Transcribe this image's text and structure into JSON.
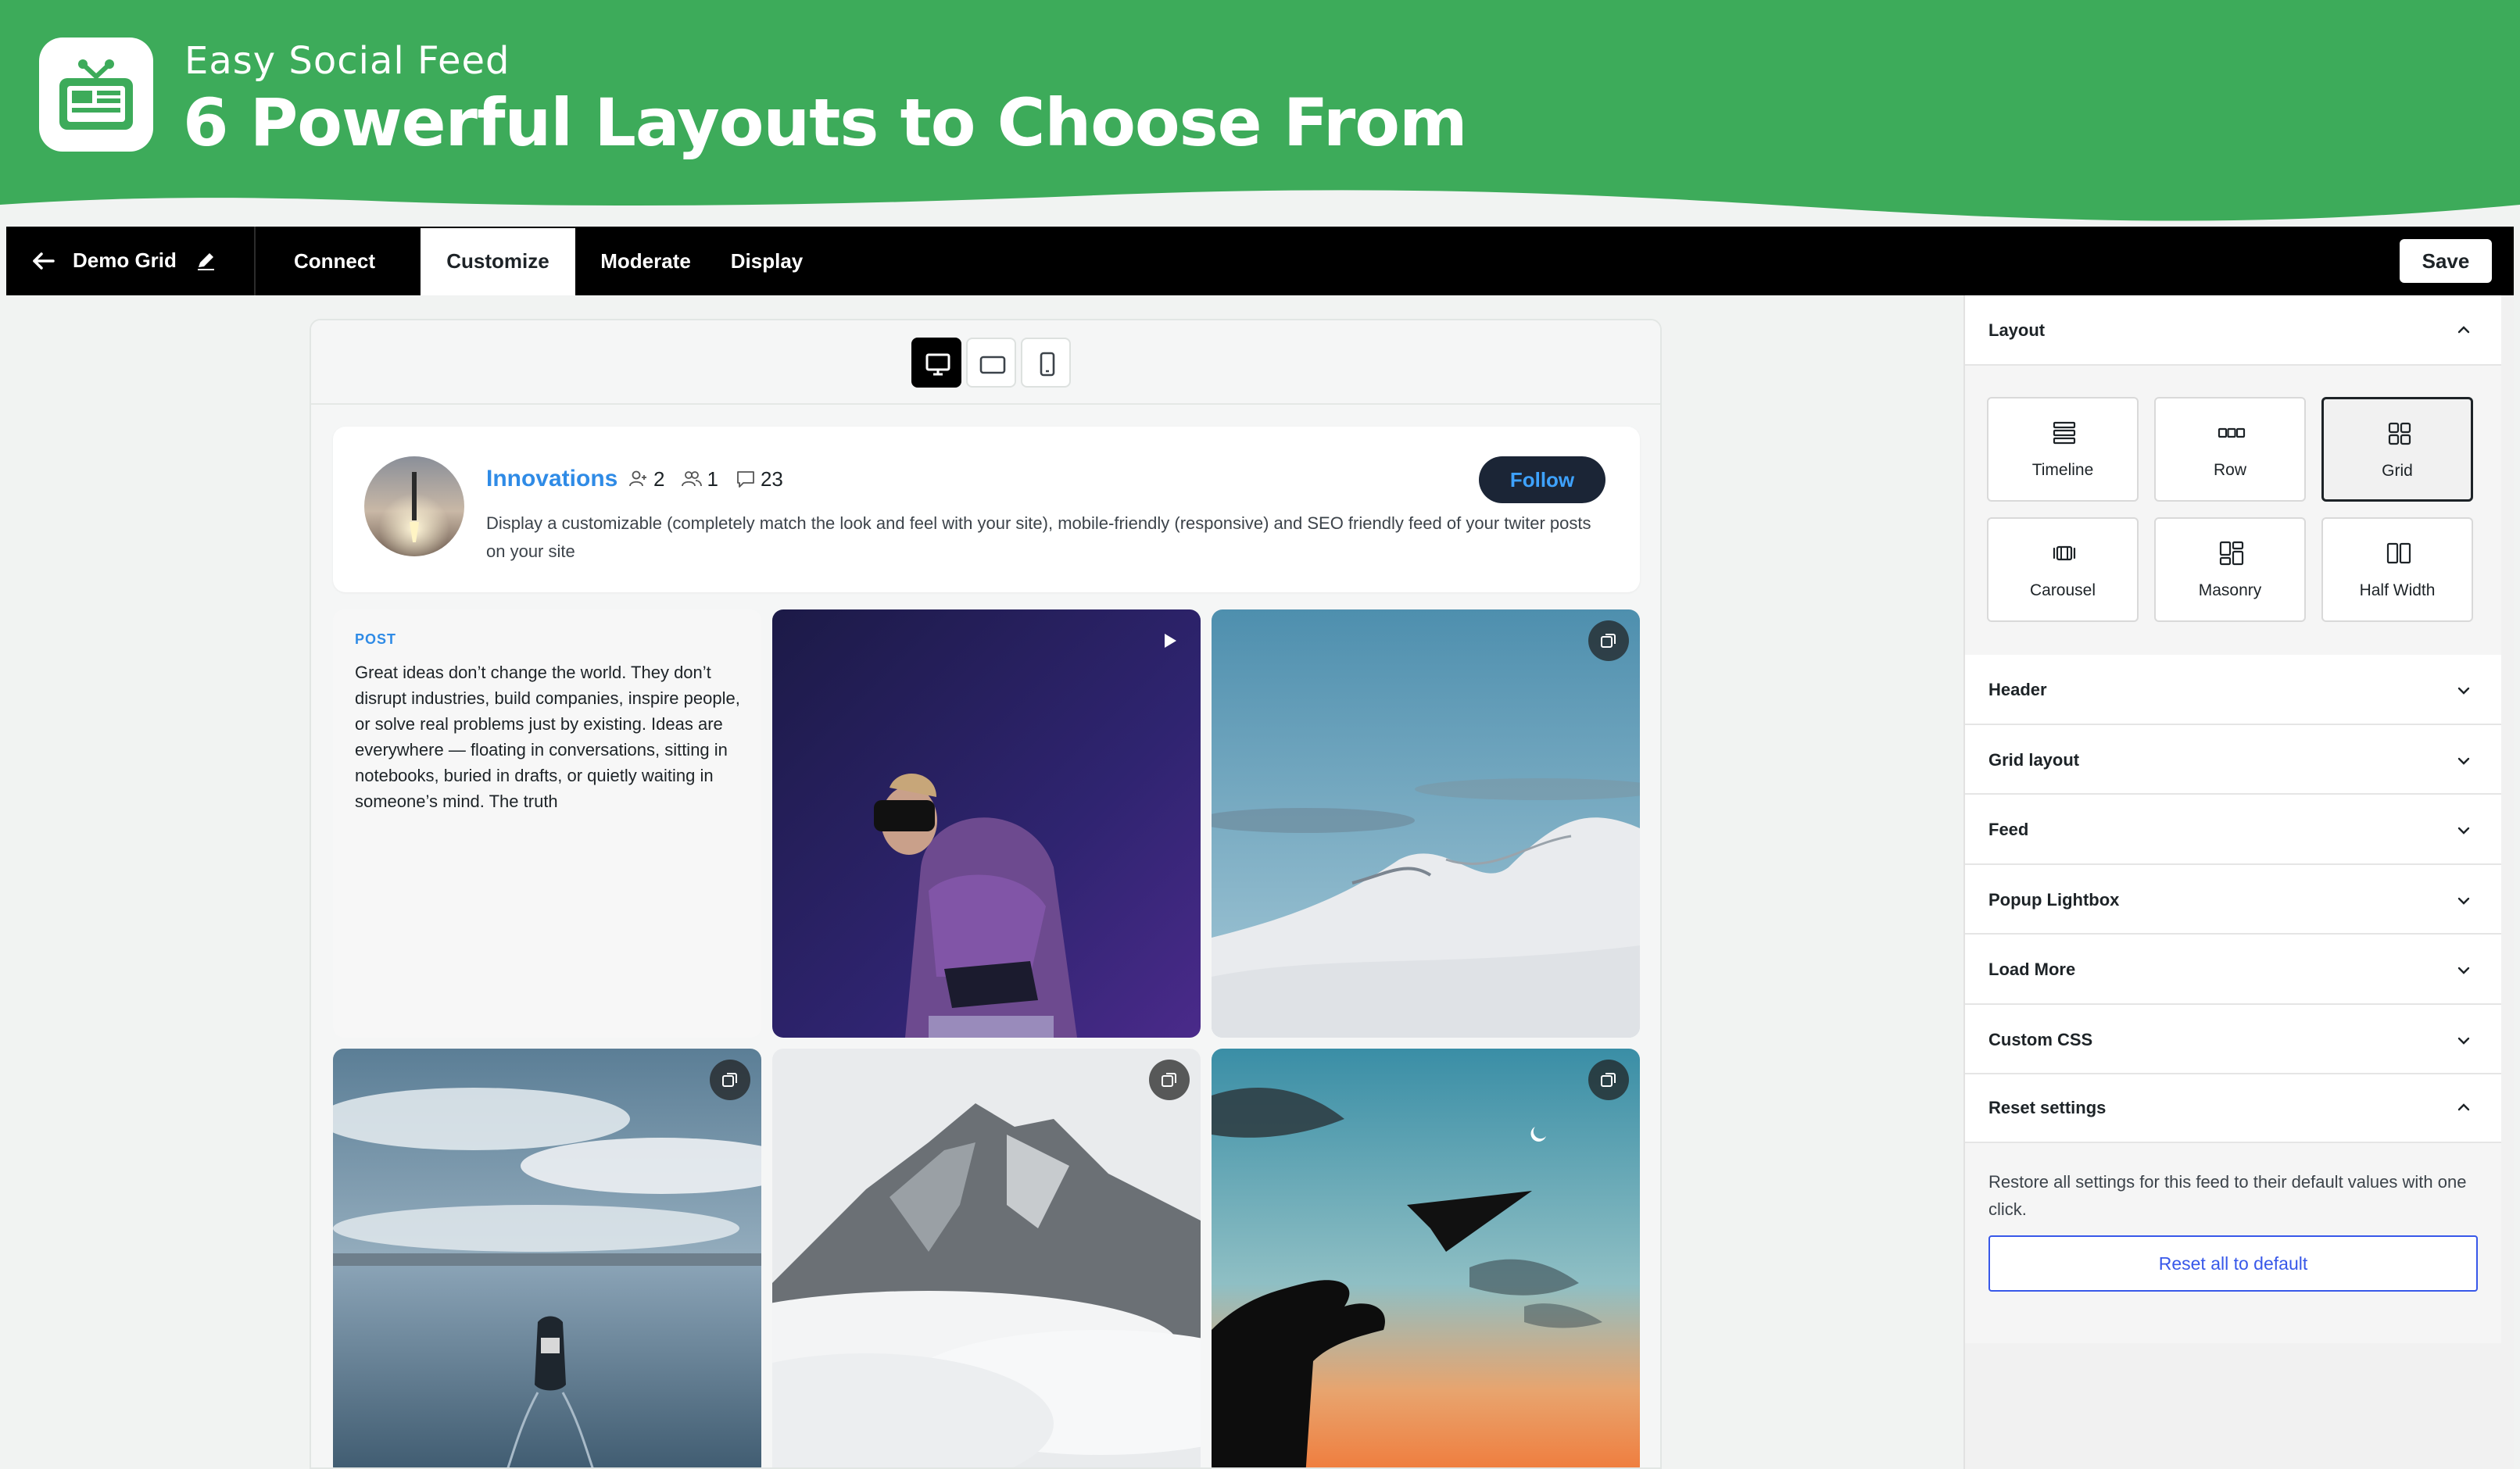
{
  "banner": {
    "subtitle": "Easy Social Feed",
    "headline": "6 Powerful Layouts to Choose From",
    "brand_color": "#3dab5a"
  },
  "topbar": {
    "feed_name": "Demo Grid",
    "tabs": [
      {
        "label": "Connect",
        "active": false
      },
      {
        "label": "Customize",
        "active": true
      },
      {
        "label": "Moderate",
        "active": false
      },
      {
        "label": "Display",
        "active": false
      }
    ],
    "save_label": "Save"
  },
  "device_toggle": {
    "options": [
      "desktop",
      "tablet",
      "mobile"
    ],
    "selected": "desktop"
  },
  "feed_header": {
    "title": "Innovations",
    "followers": "2",
    "following": "1",
    "posts": "23",
    "description": "Display a customizable (completely match the look and feel with your site), mobile-friendly (responsive) and SEO friendly feed of your twiter posts on your site",
    "follow_label": "Follow",
    "accent_color": "#2f8be6"
  },
  "posts": [
    {
      "kind": "text",
      "type_label": "POST",
      "text": "Great ideas don’t change the world. They don’t disrupt industries, build companies, inspire people, or solve real problems just by existing. Ideas are everywhere — floating in conversations, sitting in notebooks, buried in drafts, or quietly waiting in someone’s mind. The truth"
    },
    {
      "kind": "video",
      "badge_icon": "play-icon"
    },
    {
      "kind": "gallery",
      "badge_icon": "gallery-icon"
    },
    {
      "kind": "gallery",
      "badge_icon": "gallery-icon"
    },
    {
      "kind": "gallery",
      "badge_icon": "gallery-icon"
    },
    {
      "kind": "gallery",
      "badge_icon": "gallery-icon"
    }
  ],
  "sidebar": {
    "layout_title": "Layout",
    "layouts": [
      {
        "label": "Timeline",
        "icon": "timeline-icon"
      },
      {
        "label": "Row",
        "icon": "row-icon"
      },
      {
        "label": "Grid",
        "icon": "grid-icon",
        "selected": true
      },
      {
        "label": "Carousel",
        "icon": "carousel-icon"
      },
      {
        "label": "Masonry",
        "icon": "masonry-icon"
      },
      {
        "label": "Half Width",
        "icon": "half-width-icon"
      }
    ],
    "sections": [
      "Header",
      "Grid layout",
      "Feed",
      "Popup Lightbox",
      "Load More",
      "Custom CSS"
    ],
    "reset": {
      "title": "Reset settings",
      "description": "Restore all settings for this feed to their default values with one click.",
      "button_label": "Reset all to default"
    }
  }
}
